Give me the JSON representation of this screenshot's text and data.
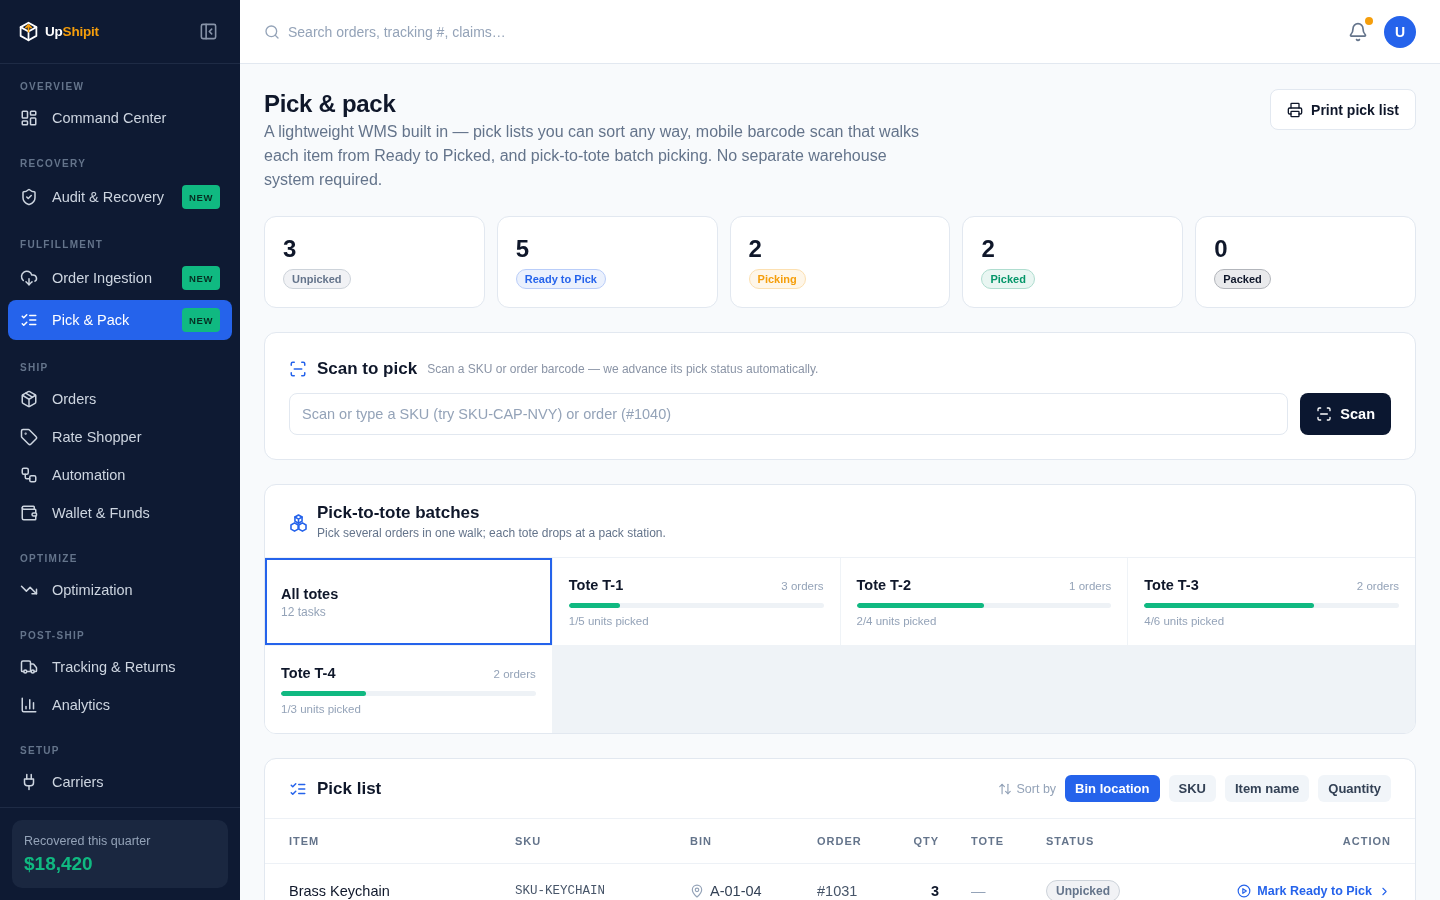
{
  "sidebar": {
    "brand": {
      "text": "Up",
      "accent": "Shipit"
    },
    "sections": [
      {
        "label": "OVERVIEW",
        "items": [
          {
            "label": "Command Center",
            "selected": false
          }
        ]
      },
      {
        "label": "RECOVERY",
        "items": [
          {
            "label": "Audit & Recovery",
            "badge": "NEW",
            "selected": false
          }
        ]
      },
      {
        "label": "FULFILLMENT",
        "items": [
          {
            "label": "Order Ingestion",
            "badge": "NEW",
            "selected": false
          },
          {
            "label": "Pick & Pack",
            "badge": "NEW",
            "selected": true
          }
        ]
      },
      {
        "label": "SHIP",
        "items": [
          {
            "label": "Orders",
            "selected": false
          },
          {
            "label": "Rate Shopper",
            "selected": false
          },
          {
            "label": "Automation",
            "selected": false
          },
          {
            "label": "Wallet & Funds",
            "selected": false
          }
        ]
      },
      {
        "label": "OPTIMIZE",
        "items": [
          {
            "label": "Optimization",
            "selected": false
          }
        ]
      },
      {
        "label": "POST-SHIP",
        "items": [
          {
            "label": "Tracking & Returns",
            "selected": false
          },
          {
            "label": "Analytics",
            "selected": false
          }
        ]
      },
      {
        "label": "SETUP",
        "items": [
          {
            "label": "Carriers",
            "selected": false
          }
        ]
      }
    ],
    "summary": {
      "label": "Recovered this quarter",
      "value": "$18,420"
    }
  },
  "topbar": {
    "search": {
      "placeholder": "Search orders, tracking #, claims…"
    },
    "notifications": {
      "unread": true
    },
    "avatar": {
      "initial": "U"
    }
  },
  "page": {
    "title": "Pick & pack",
    "description": "A lightweight WMS built in — pick lists you can sort any way, mobile barcode scan that walks each item from Ready to Picked, and pick-to-tote batch picking. No separate warehouse system required.",
    "print_button": "Print pick list"
  },
  "stats": [
    {
      "value": "3",
      "label": "Unpicked",
      "color": "#64748b"
    },
    {
      "value": "5",
      "label": "Ready to Pick",
      "color": "#2563eb"
    },
    {
      "value": "2",
      "label": "Picking",
      "color": "#f59e0b"
    },
    {
      "value": "2",
      "label": "Picked",
      "color": "#059669"
    },
    {
      "value": "0",
      "label": "Packed",
      "color": "#0f172a"
    }
  ],
  "scan": {
    "title": "Scan to pick",
    "subtitle": "Scan a SKU or order barcode — we advance its pick status automatically.",
    "placeholder": "Scan or type a SKU (try SKU-CAP-NVY) or order (#1040)",
    "button": "Scan"
  },
  "batches": {
    "title": "Pick-to-tote batches",
    "subtitle": "Pick several orders in one walk; each tote drops at a pack station.",
    "totes": [
      {
        "kind": "all",
        "name": "All totes",
        "detail": "12 tasks",
        "selected": true
      },
      {
        "kind": "tote",
        "name": "Tote T-1",
        "orders": "3 orders",
        "level": 0.2,
        "progress": "1/5 units picked",
        "selected": false
      },
      {
        "kind": "tote",
        "name": "Tote T-2",
        "orders": "1 orders",
        "level": 0.5,
        "progress": "2/4 units picked",
        "selected": false
      },
      {
        "kind": "tote",
        "name": "Tote T-3",
        "orders": "2 orders",
        "level": 0.667,
        "progress": "4/6 units picked",
        "selected": false
      },
      {
        "kind": "tote",
        "name": "Tote T-4",
        "orders": "2 orders",
        "level": 0.333,
        "progress": "1/3 units picked",
        "selected": false
      }
    ]
  },
  "pick_list": {
    "title": "Pick list",
    "sort_label": "Sort by",
    "sort_options": [
      {
        "label": "Bin location",
        "selected": true
      },
      {
        "label": "SKU",
        "selected": false
      },
      {
        "label": "Item name",
        "selected": false
      },
      {
        "label": "Quantity",
        "selected": false
      }
    ],
    "columns": [
      "ITEM",
      "SKU",
      "BIN",
      "ORDER",
      "QTY",
      "TOTE",
      "STATUS",
      "ACTION"
    ],
    "rows": [
      {
        "item": "Brass Keychain",
        "sku": "SKU-KEYCHAIN",
        "bin": "A-01-04",
        "order": "#1031",
        "qty": "3",
        "tote": "—",
        "status": {
          "label": "Unpicked",
          "color": "#64748b"
        },
        "action": "Mark Ready to Pick"
      }
    ]
  }
}
